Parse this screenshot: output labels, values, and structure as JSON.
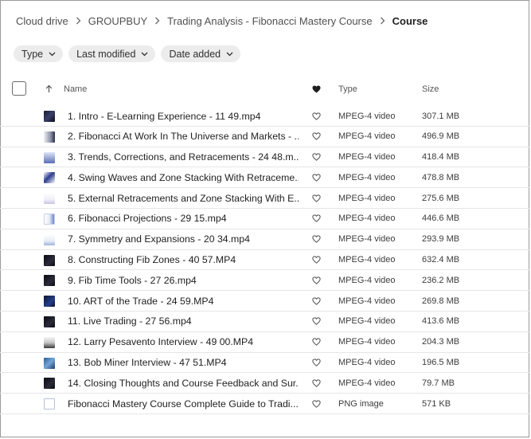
{
  "breadcrumb": [
    {
      "label": "Cloud drive"
    },
    {
      "label": "GROUPBUY"
    },
    {
      "label": "Trading Analysis - Fibonacci Mastery Course"
    },
    {
      "label": "Course"
    }
  ],
  "filters": [
    {
      "label": "Type"
    },
    {
      "label": "Last modified"
    },
    {
      "label": "Date added"
    }
  ],
  "columns": {
    "name": "Name",
    "type": "Type",
    "size": "Size"
  },
  "files": [
    {
      "name": "1. Intro - E-Learning Experience - 11 49.mp4",
      "type": "MPEG-4 video",
      "size": "307.1 MB",
      "thumb": "dark"
    },
    {
      "name": "2. Fibonacci At Work In The Universe and Markets - ...",
      "type": "MPEG-4 video",
      "size": "496.9 MB",
      "thumb": "gray"
    },
    {
      "name": "3. Trends, Corrections, and Retracements - 24 48.m...",
      "type": "MPEG-4 video",
      "size": "418.4 MB",
      "thumb": "blue"
    },
    {
      "name": "4. Swing Waves and Zone Stacking With Retraceme...",
      "type": "MPEG-4 video",
      "size": "478.8 MB",
      "thumb": "navy"
    },
    {
      "name": "5. External Retracements and Zone Stacking With E...",
      "type": "MPEG-4 video",
      "size": "275.6 MB",
      "thumb": "light"
    },
    {
      "name": "6. Fibonacci Projections - 29 15.mp4",
      "type": "MPEG-4 video",
      "size": "446.6 MB",
      "thumb": "doc"
    },
    {
      "name": "7. Symmetry and Expansions - 20 34.mp4",
      "type": "MPEG-4 video",
      "size": "293.9 MB",
      "thumb": "white"
    },
    {
      "name": "8. Constructing Fib Zones - 40 57.MP4",
      "type": "MPEG-4 video",
      "size": "632.4 MB",
      "thumb": "chart"
    },
    {
      "name": "9. Fib Time Tools - 27 26.mp4",
      "type": "MPEG-4 video",
      "size": "236.2 MB",
      "thumb": "chart"
    },
    {
      "name": "10. ART of the Trade - 24 59.MP4",
      "type": "MPEG-4 video",
      "size": "269.8 MB",
      "thumb": "chartb"
    },
    {
      "name": "11. Live Trading - 27 56.mp4",
      "type": "MPEG-4 video",
      "size": "413.6 MB",
      "thumb": "chart"
    },
    {
      "name": "12. Larry Pesavento Interview - 49 00.MP4",
      "type": "MPEG-4 video",
      "size": "204.3 MB",
      "thumb": "slide"
    },
    {
      "name": "13. Bob Miner Interview - 47 51.MP4",
      "type": "MPEG-4 video",
      "size": "196.5 MB",
      "thumb": "ocean"
    },
    {
      "name": "14. Closing Thoughts and Course Feedback and Sur...",
      "type": "MPEG-4 video",
      "size": "79.7 MB",
      "thumb": "chart"
    },
    {
      "name": "Fibonacci Mastery Course Complete Guide to Tradi...",
      "type": "PNG image",
      "size": "571 KB",
      "thumb": "outline"
    }
  ]
}
